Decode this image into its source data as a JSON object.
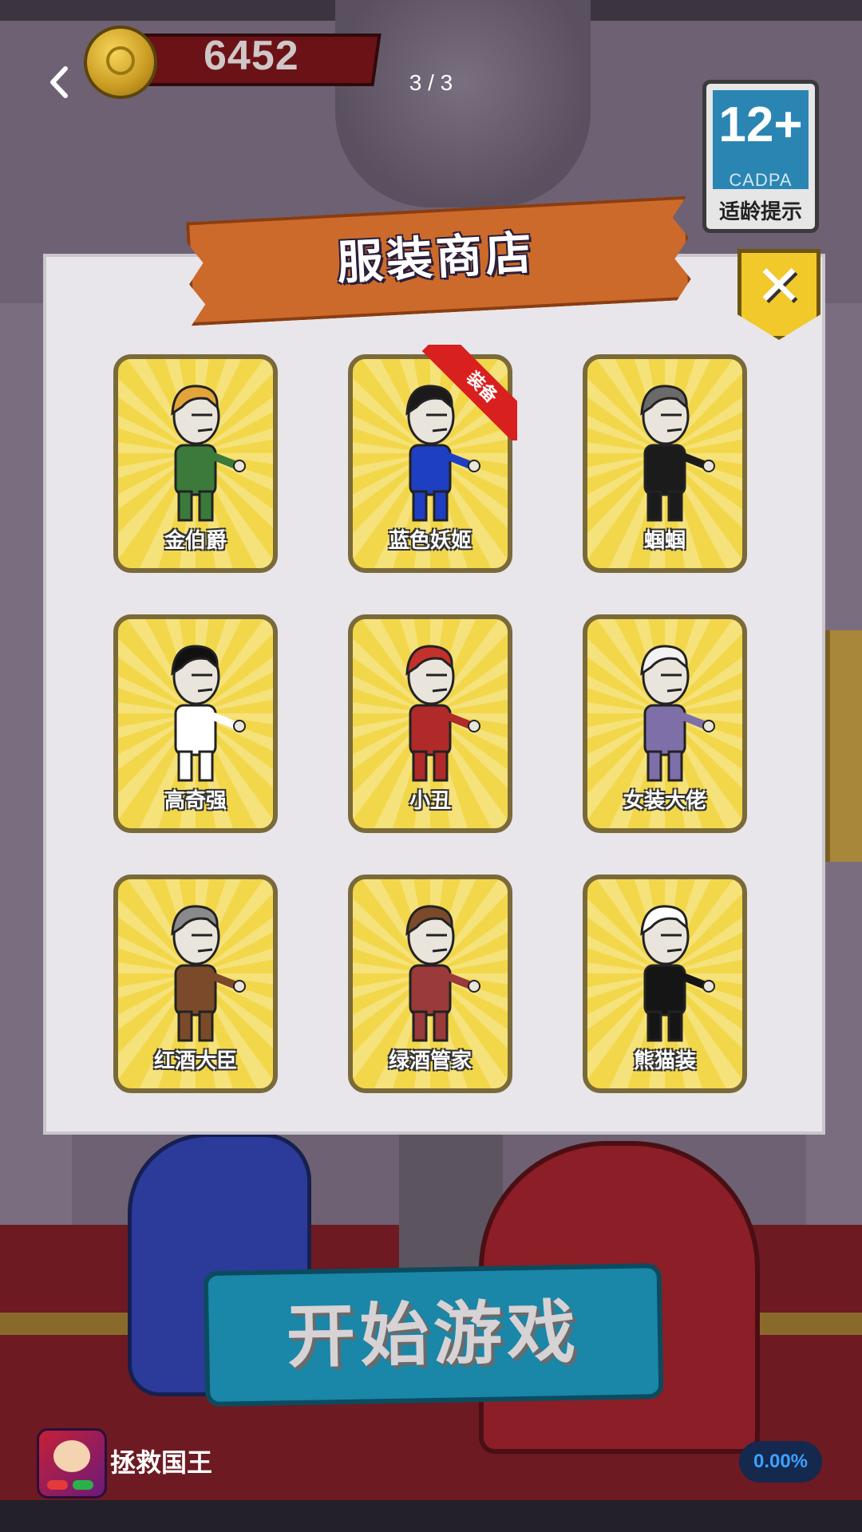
{
  "hud": {
    "coins": "6452",
    "page_counter": "3 / 3",
    "age_rating": "12+",
    "age_org": "CADPA",
    "age_tip": "适龄提示"
  },
  "shop": {
    "title": "服装商店",
    "ribbon_label": "装备",
    "costumes": [
      {
        "name": "金伯爵",
        "hair": "#e3a43a",
        "outfit": "#3b7a3a"
      },
      {
        "name": "蓝色妖姬",
        "hair": "#1a1a1a",
        "outfit": "#1e3fc2"
      },
      {
        "name": "蝈蝈",
        "hair": "#6a6a6a",
        "outfit": "#1b1b1b"
      },
      {
        "name": "高奇强",
        "hair": "#111111",
        "outfit": "#ffffff"
      },
      {
        "name": "小丑",
        "hair": "#c4302b",
        "outfit": "#b02a2a"
      },
      {
        "name": "女装大佬",
        "hair": "#f2f2f2",
        "outfit": "#7e6fa8"
      },
      {
        "name": "红酒大臣",
        "hair": "#8a8a8a",
        "outfit": "#7a4a2a"
      },
      {
        "name": "绿酒管家",
        "hair": "#7a4a2a",
        "outfit": "#9a3a3a"
      },
      {
        "name": "熊猫装",
        "hair": "#ffffff",
        "outfit": "#151515"
      }
    ]
  },
  "start_button": {
    "label": "开始游戏"
  },
  "app_bar": {
    "name": "拯救国王",
    "progress": "0.00%"
  }
}
